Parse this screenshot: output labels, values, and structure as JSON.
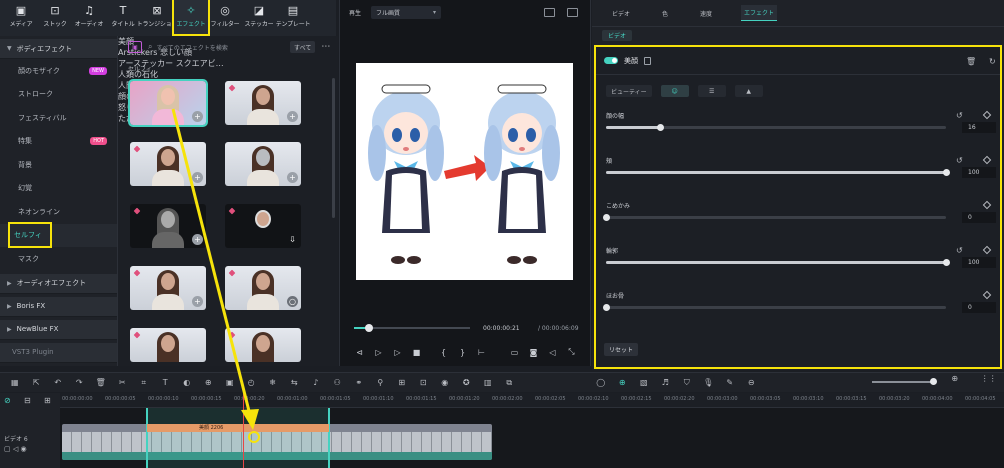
{
  "toolbar": {
    "items": [
      {
        "label": "メディア",
        "icon": "media-icon"
      },
      {
        "label": "ストック",
        "icon": "stock-icon"
      },
      {
        "label": "オーディオ",
        "icon": "audio-icon"
      },
      {
        "label": "タイトル",
        "icon": "title-icon"
      },
      {
        "label": "トランジション",
        "icon": "transition-icon"
      },
      {
        "label": "エフェクト",
        "icon": "effect-icon",
        "active": true
      },
      {
        "label": "フィルター",
        "icon": "filter-icon"
      },
      {
        "label": "ステッカー",
        "icon": "sticker-icon"
      },
      {
        "label": "テンプレート",
        "icon": "template-icon"
      }
    ]
  },
  "sidebar": {
    "header": "ボディエフェクト",
    "items": [
      {
        "label": "顔のモザイク",
        "badge": "NEW"
      },
      {
        "label": "ストローク"
      },
      {
        "label": "フェスティバル"
      },
      {
        "label": "特集",
        "badge": "HOT"
      },
      {
        "label": "背景"
      },
      {
        "label": "幻覚"
      },
      {
        "label": "ネオンライン"
      },
      {
        "label": "セルフィ",
        "selected": true
      },
      {
        "label": "マスク"
      }
    ],
    "groups": [
      "オーディオエフェクト",
      "Boris FX",
      "NewBlue FX",
      "VST3 Plugin"
    ]
  },
  "effects": {
    "search_placeholder": "すべてのエフェクトを検索",
    "filter_label": "すべて",
    "section": "セルフィ",
    "cards": [
      {
        "label": "美顔"
      },
      {
        "label": "Arstickers 悲しい顔"
      },
      {
        "label": "アーステッカー スクエアビ…"
      },
      {
        "label": "人類の石化"
      },
      {
        "label": "人間のひび割れ"
      },
      {
        "label": "顔のハイライト"
      },
      {
        "label": "怒り"
      },
      {
        "label": "ただれ"
      }
    ]
  },
  "preview": {
    "play_label": "再生",
    "quality": "フル画質",
    "current_time": "00:00:00:21",
    "total_time": "/ 00:00:06:09",
    "progress": 0.12
  },
  "props": {
    "tabs": [
      "ビデオ",
      "色",
      "速度",
      "エフェクト"
    ],
    "active_tab": "エフェクト",
    "subtab": "ビデオ",
    "effect_name": "美顔",
    "modes": [
      "ビューティー",
      "顔",
      "目",
      "鼻"
    ],
    "params": [
      {
        "name": "顔の幅",
        "value": "16",
        "fraction": 0.16
      },
      {
        "name": "頬",
        "value": "100",
        "fraction": 1.0
      },
      {
        "name": "こめかみ",
        "value": "0",
        "fraction": 0.0
      },
      {
        "name": "輪郭",
        "value": "100",
        "fraction": 1.0
      },
      {
        "name": "ほお骨",
        "value": "0",
        "fraction": 0.0
      }
    ],
    "reset_label": "リセット"
  },
  "timeline": {
    "ruler": [
      "00:00:00:00",
      "00:00:00:05",
      "00:00:00:10",
      "00:00:00:15",
      "00:00:00:20",
      "00:00:01:00",
      "00:00:01:05",
      "00:00:01:10",
      "00:00:01:15",
      "00:00:01:20",
      "00:00:02:00",
      "00:00:02:05",
      "00:00:02:10",
      "00:00:02:15",
      "00:00:02:20",
      "00:00:03:00",
      "00:00:03:05",
      "00:00:03:10",
      "00:00:03:15",
      "00:00:03:20",
      "00:00:04:00",
      "00:00:04:05"
    ],
    "track_label": "ビデオ 6",
    "fx_clip_label": "美顔 2206"
  },
  "colors": {
    "accent": "#45d2c0",
    "highlight": "#f6e30b",
    "playhead": "#e84545"
  }
}
